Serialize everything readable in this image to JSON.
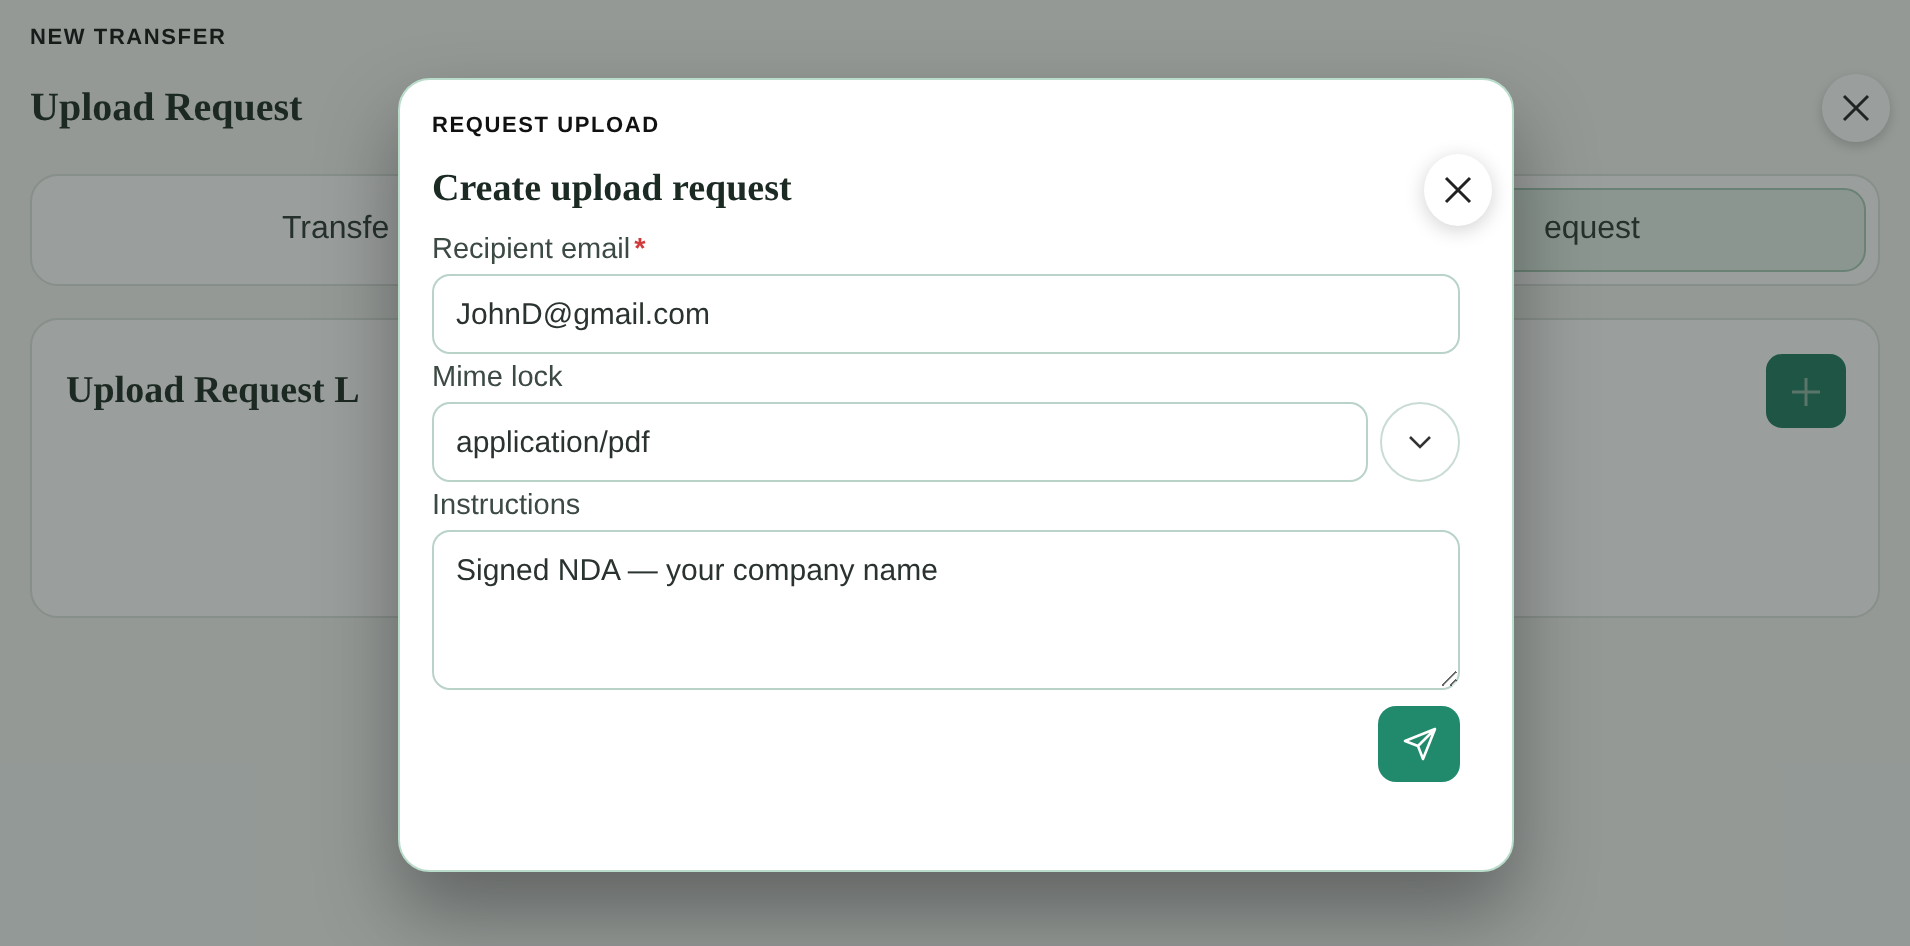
{
  "page": {
    "eyebrow": "NEW TRANSFER",
    "title": "Upload Request"
  },
  "tabs": [
    {
      "label": "Transfe",
      "selected": false
    },
    {
      "label": "equest",
      "selected": true
    }
  ],
  "list_card": {
    "title": "Upload Request L"
  },
  "dialog": {
    "eyebrow": "REQUEST UPLOAD",
    "title": "Create upload request",
    "fields": [
      {
        "kind": "text",
        "label": "Recipient email",
        "required": true,
        "value": "JohnD@gmail.com"
      },
      {
        "kind": "select",
        "label": "Mime lock",
        "required": false,
        "value": "application/pdf"
      },
      {
        "kind": "textarea",
        "label": "Instructions",
        "required": false,
        "value": "Signed NDA — your company name"
      }
    ],
    "required_mark": "*"
  }
}
